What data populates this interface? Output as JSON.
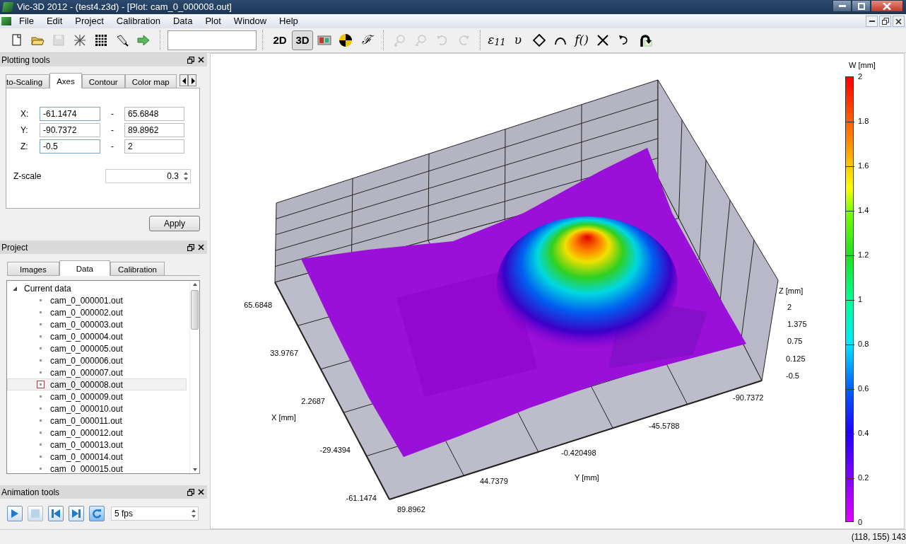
{
  "window": {
    "title": "Vic-3D 2012 - (test4.z3d) - [Plot: cam_0_000008.out]"
  },
  "menu": [
    "File",
    "Edit",
    "Project",
    "Calibration",
    "Data",
    "Plot",
    "Window",
    "Help"
  ],
  "toolbar": [
    {
      "kind": "icon",
      "disabled": false
    },
    {
      "kind": "icon",
      "disabled": false
    },
    {
      "kind": "icon",
      "disabled": true
    },
    {
      "kind": "icon",
      "disabled": false
    },
    {
      "kind": "icon",
      "disabled": false
    },
    {
      "kind": "icon",
      "disabled": false
    },
    {
      "kind": "icon",
      "disabled": false
    },
    {
      "kind": "field"
    },
    {
      "kind": "text",
      "label": "2D",
      "selected": false
    },
    {
      "kind": "text",
      "label": "3D",
      "selected": true
    },
    {
      "kind": "icon",
      "disabled": false
    },
    {
      "kind": "icon",
      "disabled": false
    },
    {
      "kind": "script",
      "label": "ℱ"
    },
    {
      "kind": "icon",
      "disabled": true
    },
    {
      "kind": "icon",
      "disabled": true
    },
    {
      "kind": "icon",
      "disabled": true
    },
    {
      "kind": "icon",
      "disabled": true
    },
    {
      "kind": "script",
      "label": "ε$_{11}$"
    },
    {
      "kind": "script",
      "label": "υ"
    },
    {
      "kind": "icon",
      "disabled": false
    },
    {
      "kind": "icon",
      "disabled": false
    },
    {
      "kind": "script",
      "label": "f()"
    },
    {
      "kind": "icon",
      "disabled": false
    },
    {
      "kind": "icon",
      "disabled": false
    },
    {
      "kind": "icon",
      "disabled": false
    }
  ],
  "plotting_tools": {
    "title": "Plotting tools",
    "tabs": [
      {
        "label": "to-Scaling",
        "selected": false
      },
      {
        "label": "Axes",
        "selected": true
      },
      {
        "label": "Contour",
        "selected": false
      },
      {
        "label": "Color map",
        "selected": false
      }
    ],
    "axes": [
      {
        "label": "X:",
        "min": "-61.1474",
        "separator": "-",
        "max": "65.6848"
      },
      {
        "label": "Y:",
        "min": "-90.7372",
        "separator": "-",
        "max": "89.8962"
      },
      {
        "label": "Z:",
        "min": "-0.5",
        "separator": "-",
        "max": "2"
      }
    ],
    "z_scale": {
      "label": "Z-scale",
      "value": "0.3"
    },
    "apply": "Apply"
  },
  "project": {
    "title": "Project",
    "tabs": [
      {
        "label": "Images",
        "selected": false
      },
      {
        "label": "Data",
        "selected": true
      },
      {
        "label": "Calibration",
        "selected": false
      }
    ],
    "tree": [
      {
        "label": "Current data",
        "expanded": true,
        "children": [
          {
            "label": "cam_0_000001.out",
            "selected": false
          },
          {
            "label": "cam_0_000002.out",
            "selected": false
          },
          {
            "label": "cam_0_000003.out",
            "selected": false
          },
          {
            "label": "cam_0_000004.out",
            "selected": false
          },
          {
            "label": "cam_0_000005.out",
            "selected": false
          },
          {
            "label": "cam_0_000006.out",
            "selected": false
          },
          {
            "label": "cam_0_000007.out",
            "selected": false
          },
          {
            "label": "cam_0_000008.out",
            "selected": true
          },
          {
            "label": "cam_0_000009.out",
            "selected": false
          },
          {
            "label": "cam_0_000010.out",
            "selected": false
          },
          {
            "label": "cam_0_000011.out",
            "selected": false
          },
          {
            "label": "cam_0_000012.out",
            "selected": false
          },
          {
            "label": "cam_0_000013.out",
            "selected": false
          },
          {
            "label": "cam_0_000014.out",
            "selected": false
          },
          {
            "label": "cam_0_000015.out",
            "selected": false
          }
        ]
      }
    ]
  },
  "animation_tools": {
    "title": "Animation tools",
    "buttons": [
      {
        "kind": "play",
        "disabled": false
      },
      {
        "kind": "stop",
        "disabled": true
      },
      {
        "kind": "first",
        "disabled": false
      },
      {
        "kind": "last",
        "disabled": false
      },
      {
        "kind": "loop",
        "on": true
      }
    ],
    "fps": "5 fps"
  },
  "plot": {
    "x_axis": {
      "title": "X [mm]",
      "ticks": [
        "65.6848",
        "33.9767",
        "2.2687",
        "-29.4394",
        "-61.1474"
      ]
    },
    "y_axis": {
      "title": "Y [mm]",
      "ticks": [
        "89.8962",
        "44.7379",
        "-0.420498",
        "-45.5788",
        "-90.7372"
      ]
    },
    "z_axis": {
      "title": "Z [mm]",
      "ticks": [
        "2",
        "1.375",
        "0.75",
        "0.125",
        "-0.5"
      ]
    },
    "colorbar": {
      "title": "W [mm]",
      "ticks": [
        "2",
        "1.8",
        "1.6",
        "1.4",
        "1.2",
        "1",
        "0.8",
        "0.6",
        "0.4",
        "0.2",
        "0"
      ]
    }
  },
  "status_bar": {
    "coordinates": "(118, 155) 143"
  }
}
